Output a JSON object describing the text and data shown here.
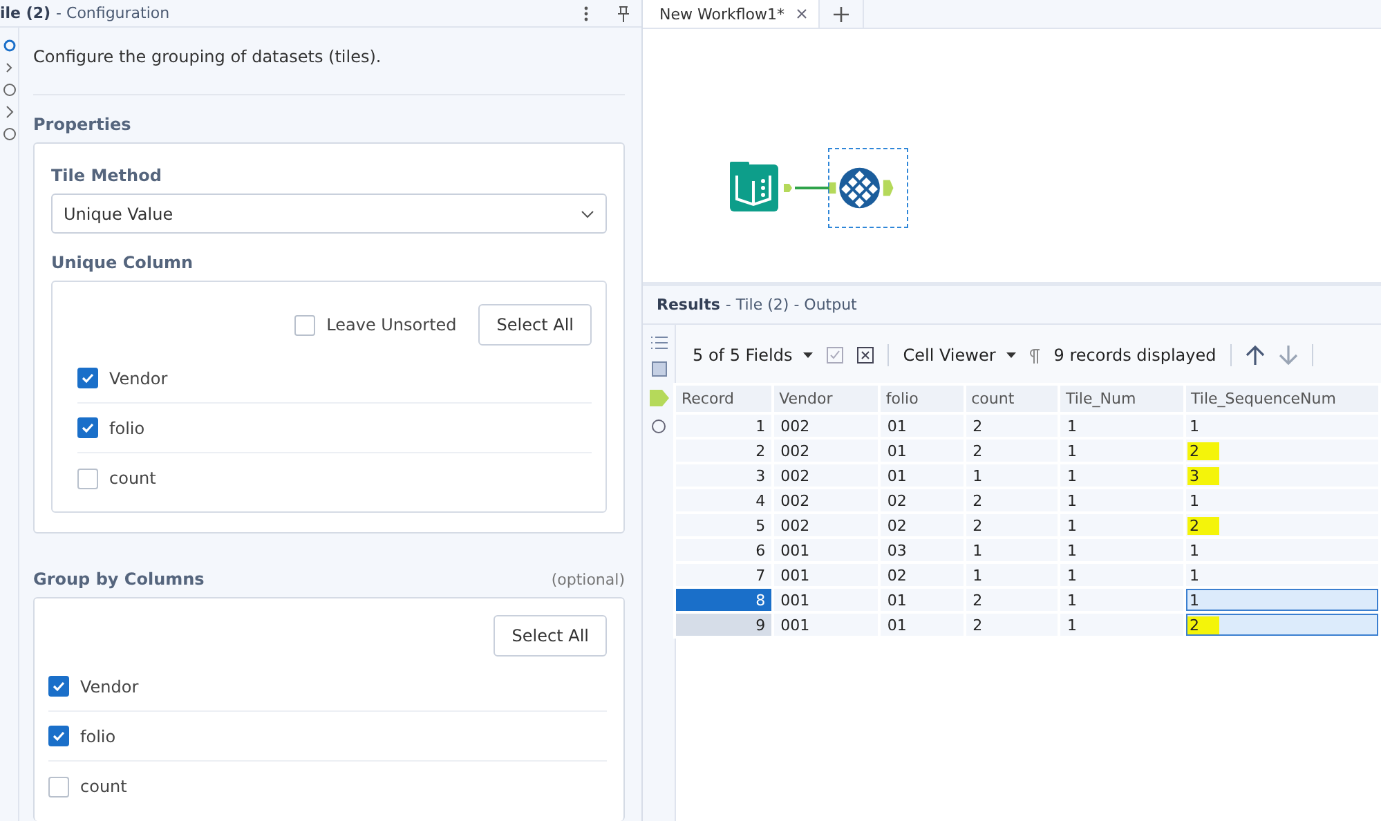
{
  "config": {
    "title": "ile (2)",
    "subtitle": "- Configuration",
    "description": "Configure the grouping of datasets (tiles).",
    "section": "Properties",
    "tile_method": {
      "label": "Tile Method",
      "value": "Unique Value"
    },
    "unique_column": {
      "label": "Unique Column",
      "leave_unsorted": {
        "label": "Leave Unsorted",
        "checked": false
      },
      "select_all": "Select All",
      "items": [
        {
          "label": "Vendor",
          "checked": true
        },
        {
          "label": "folio",
          "checked": true
        },
        {
          "label": "count",
          "checked": false
        }
      ]
    },
    "group_by": {
      "label": "Group by Columns",
      "hint": "(optional)",
      "select_all": "Select All",
      "items": [
        {
          "label": "Vendor",
          "checked": true
        },
        {
          "label": "folio",
          "checked": true
        },
        {
          "label": "count",
          "checked": false
        }
      ]
    }
  },
  "tabs": [
    {
      "label": "New Workflow1*",
      "selected": true
    }
  ],
  "results": {
    "title": "Results",
    "subtitle": "- Tile (2) - Output",
    "fields": "5 of 5 Fields",
    "viewer": "Cell Viewer",
    "records": "9 records displayed",
    "columns": [
      "Record",
      "Vendor",
      "folio",
      "count",
      "Tile_Num",
      "Tile_SequenceNum"
    ],
    "rows": [
      {
        "cells": [
          "1",
          "002",
          "01",
          "2",
          "1",
          "1"
        ],
        "highlighted": false,
        "selected": false,
        "active": false
      },
      {
        "cells": [
          "2",
          "002",
          "01",
          "2",
          "1",
          "2"
        ],
        "highlighted": true,
        "selected": false,
        "active": false
      },
      {
        "cells": [
          "3",
          "002",
          "01",
          "1",
          "1",
          "3"
        ],
        "highlighted": true,
        "selected": false,
        "active": false
      },
      {
        "cells": [
          "4",
          "002",
          "02",
          "2",
          "1",
          "1"
        ],
        "highlighted": false,
        "selected": false,
        "active": false
      },
      {
        "cells": [
          "5",
          "002",
          "02",
          "2",
          "1",
          "2"
        ],
        "highlighted": true,
        "selected": false,
        "active": false
      },
      {
        "cells": [
          "6",
          "001",
          "03",
          "1",
          "1",
          "1"
        ],
        "highlighted": false,
        "selected": false,
        "active": false
      },
      {
        "cells": [
          "7",
          "001",
          "02",
          "1",
          "1",
          "1"
        ],
        "highlighted": false,
        "selected": false,
        "active": false
      },
      {
        "cells": [
          "8",
          "001",
          "01",
          "2",
          "1",
          "1"
        ],
        "highlighted": false,
        "selected": true,
        "active": true
      },
      {
        "cells": [
          "9",
          "001",
          "01",
          "2",
          "1",
          "2"
        ],
        "highlighted": true,
        "selected": true,
        "active": false
      }
    ]
  }
}
